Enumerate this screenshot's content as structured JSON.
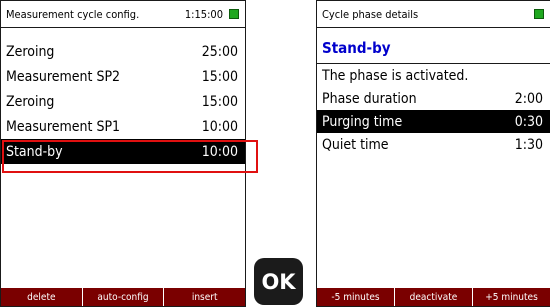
{
  "left_screen": {
    "title": "Measurement cycle config.",
    "time": "1:15:00",
    "rows": [
      {
        "label": "Zeroing",
        "value": "25:00"
      },
      {
        "label": "Measurement SP2",
        "value": "15:00"
      },
      {
        "label": "Zeroing",
        "value": "15:00"
      },
      {
        "label": "Measurement SP1",
        "value": "10:00"
      },
      {
        "label": "Stand-by",
        "value": "10:00"
      }
    ],
    "selected_index": 4,
    "softkeys": [
      "delete",
      "auto-config",
      "insert"
    ]
  },
  "ok_key": {
    "label": "OK"
  },
  "right_screen": {
    "title": "Cycle phase details",
    "heading": "Stand-by",
    "status": "The phase is activated.",
    "rows": [
      {
        "label": "Phase duration",
        "value": "2:00"
      },
      {
        "label": "Purging time",
        "value": "0:30"
      },
      {
        "label": "Quiet time",
        "value": "1:30"
      }
    ],
    "selected_index": 1,
    "softkeys": [
      "-5 minutes",
      "deactivate",
      "+5 minutes"
    ]
  },
  "colors": {
    "battery": "#1fa81f",
    "softkey_bar": "#7a0000",
    "heading": "#0000cc",
    "highlight_box": "#e01010"
  }
}
